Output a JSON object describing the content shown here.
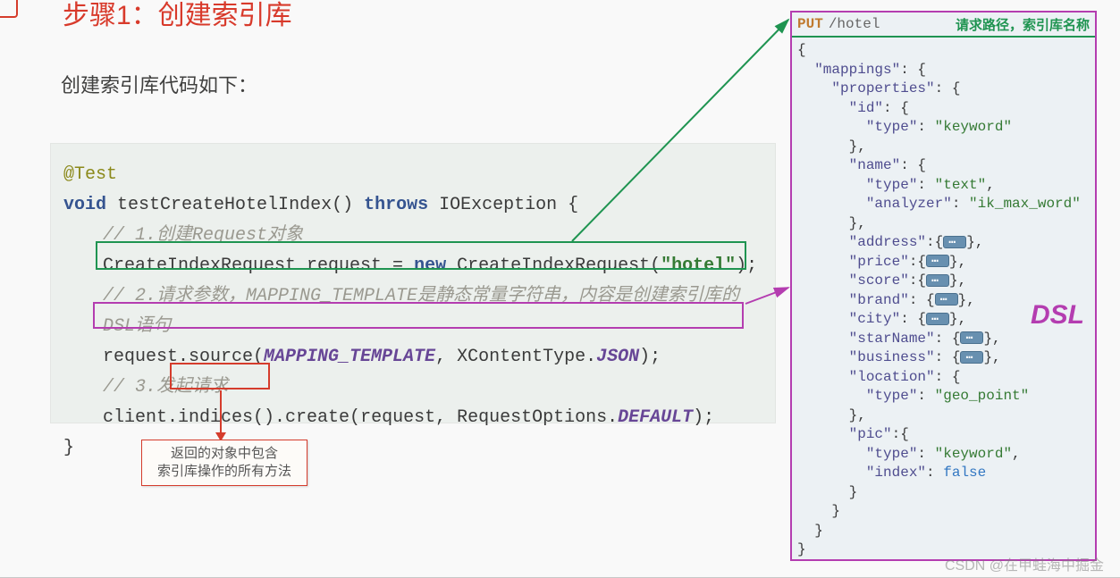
{
  "title_partial": "步骤1：创建索引库",
  "subtitle": "创建索引库代码如下：",
  "code": {
    "annot": "@Test",
    "kw_void": "void",
    "fn_name": "testCreateHotelIndex()",
    "kw_throws": "throws",
    "exc": "IOException {",
    "cmt1": "// 1.创建Request对象",
    "line2a": "CreateIndexRequest request = ",
    "kw_new": "new",
    "line2b": " CreateIndexRequest(",
    "str_hotel": "\"hotel\"",
    "line2c": ");",
    "cmt2a": "// 2.请求参数，",
    "cmt2b": "MAPPING_TEMPLATE",
    "cmt2c": "是静态常量字符串，内容是创建索引库的",
    "cmt2d": "DSL",
    "cmt2e": "语句",
    "line3a": "request.source(",
    "const_mt": "MAPPING_TEMPLATE",
    "line3b": ", XContentType.",
    "const_json": "JSON",
    "line3c": ");",
    "cmt3": "// 3.发起请求",
    "line4a": "client.",
    "line4b": "indices()",
    "line4c": ".create(request, RequestOptions.",
    "const_def": "DEFAULT",
    "line4d": ");",
    "brace_close": "}"
  },
  "note": {
    "l1": "返回的对象中包含",
    "l2": "索引库操作的所有方法"
  },
  "dsl": {
    "http_method": "PUT",
    "http_path": "/hotel",
    "header_note": "请求路径，索引库名称",
    "big_label": "DSL",
    "kw_mappings": "\"mappings\"",
    "kw_properties": "\"properties\"",
    "kw_id": "\"id\"",
    "kw_type": "\"type\"",
    "v_keyword": "\"keyword\"",
    "kw_name": "\"name\"",
    "v_text": "\"text\"",
    "kw_analyzer": "\"analyzer\"",
    "v_ik": "\"ik_max_word\"",
    "kw_address": "\"address\"",
    "kw_price": "\"price\"",
    "kw_score": "\"score\"",
    "kw_brand": "\"brand\"",
    "kw_city": "\"city\"",
    "kw_starName": "\"starName\"",
    "kw_business": "\"business\"",
    "kw_location": "\"location\"",
    "v_geo": "\"geo_point\"",
    "kw_pic": "\"pic\"",
    "kw_index": "\"index\"",
    "v_false": "false"
  },
  "watermark": "CSDN @在甲蛙海中掘金"
}
